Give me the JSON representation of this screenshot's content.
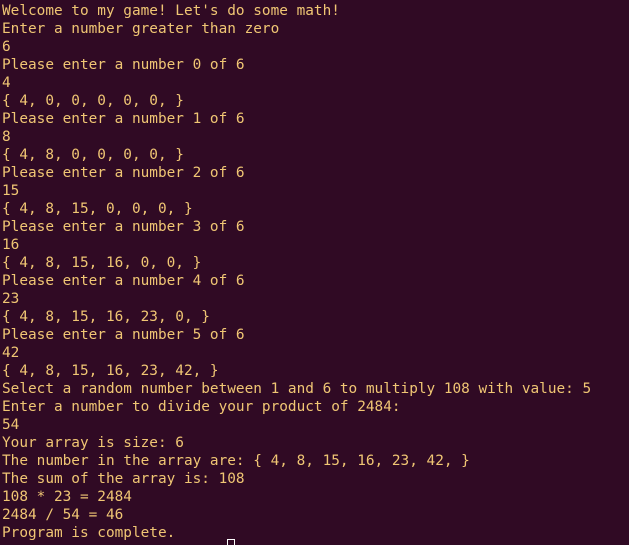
{
  "terminal": {
    "lines": [
      "Welcome to my game! Let's do some math!",
      "Enter a number greater than zero",
      "6",
      "Please enter a number 0 of 6",
      "4",
      "{ 4, 0, 0, 0, 0, 0, }",
      "Please enter a number 1 of 6",
      "8",
      "{ 4, 8, 0, 0, 0, 0, }",
      "Please enter a number 2 of 6",
      "15",
      "{ 4, 8, 15, 0, 0, 0, }",
      "Please enter a number 3 of 6",
      "16",
      "{ 4, 8, 15, 16, 0, 0, }",
      "Please enter a number 4 of 6",
      "23",
      "{ 4, 8, 15, 16, 23, 0, }",
      "Please enter a number 5 of 6",
      "42",
      "{ 4, 8, 15, 16, 23, 42, }",
      "Select a random number between 1 and 6 to multiply 108 with value: 5",
      "Enter a number to divide your product of 2484:",
      "54",
      "Your array is size: 6",
      "The number in the array are: { 4, 8, 15, 16, 23, 42, }",
      "The sum of the array is: 108",
      "108 * 23 = 2484",
      "2484 / 54 = 46",
      "Program is complete."
    ],
    "colors": {
      "background": "#300a24",
      "text": "#f0c674",
      "cursor": "#ffffff"
    }
  }
}
